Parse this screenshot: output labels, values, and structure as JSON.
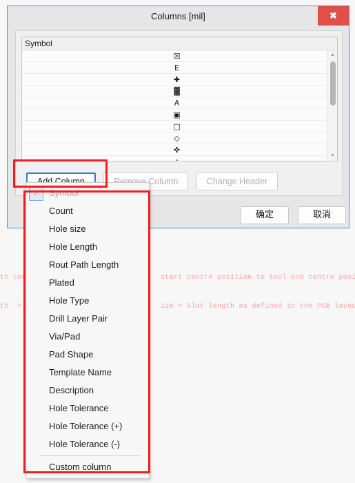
{
  "window": {
    "title": "Columns [mil]",
    "close_label": "✖",
    "close_icon": "close-icon"
  },
  "list": {
    "header": "Symbol",
    "rows": [
      {
        "glyph": "☒",
        "icon": "crossed-square-symbol"
      },
      {
        "glyph": "E",
        "icon": "letter-e-symbol"
      },
      {
        "glyph": "✚",
        "icon": "bold-cross-symbol"
      },
      {
        "glyph": "▓",
        "icon": "hatched-square-symbol"
      },
      {
        "glyph": "A",
        "icon": "letter-a-symbol"
      },
      {
        "glyph": "▣",
        "icon": "square-in-square-symbol"
      },
      {
        "glyph": "□",
        "icon": "square-symbol"
      },
      {
        "glyph": "◇",
        "icon": "diamond-symbol"
      },
      {
        "glyph": "✜",
        "icon": "cross-symbol"
      },
      {
        "glyph": "✧",
        "icon": "partial-symbol"
      }
    ],
    "scrollbar": {
      "up_arrow": "▲",
      "down_arrow": "▼"
    }
  },
  "buttons": {
    "add_column": "Add Column",
    "remove_column": "Remove Column",
    "change_header": "Change Header"
  },
  "footer": {
    "ok": "确定",
    "cancel": "取消"
  },
  "menu": {
    "items": [
      {
        "label": "Symbol",
        "disabled": true,
        "checked": true
      },
      {
        "label": "Count",
        "disabled": false,
        "checked": false
      },
      {
        "label": "Hole size",
        "disabled": false,
        "checked": false
      },
      {
        "label": "Hole Length",
        "disabled": false,
        "checked": false
      },
      {
        "label": "Rout Path Length",
        "disabled": false,
        "checked": false
      },
      {
        "label": "Plated",
        "disabled": false,
        "checked": false
      },
      {
        "label": "Hole Type",
        "disabled": false,
        "checked": false
      },
      {
        "label": "Drill Layer Pair",
        "disabled": false,
        "checked": false
      },
      {
        "label": "Via/Pad",
        "disabled": false,
        "checked": false
      },
      {
        "label": "Pad Shape",
        "disabled": false,
        "checked": false
      },
      {
        "label": "Template Name",
        "disabled": false,
        "checked": false
      },
      {
        "label": "Description",
        "disabled": false,
        "checked": false
      },
      {
        "label": "Hole Tolerance",
        "disabled": false,
        "checked": false
      },
      {
        "label": "Hole Tolerance (+)",
        "disabled": false,
        "checked": false
      },
      {
        "label": "Hole Tolerance (-)",
        "disabled": false,
        "checked": false
      },
      {
        "separator": true
      },
      {
        "label": "Custom column",
        "disabled": false,
        "checked": false
      }
    ],
    "check_glyph": "✓"
  },
  "background_text": {
    "line1": "th Length                            start centre position to tool end centre position.",
    "line2": "th  =                                ize = Slot length as defined in the PCB layout     ."
  },
  "colors": {
    "accent": "#3d93dd",
    "close_button": "#e04f4a",
    "annotation": "#f41c1c",
    "background_text": "#fa9f9f",
    "focus_border": "#2a7fd4"
  }
}
